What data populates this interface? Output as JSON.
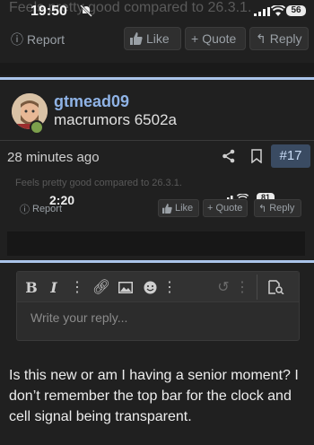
{
  "statusbar": {
    "time": "19:50",
    "battery": "56"
  },
  "prev_post": {
    "ghost_text": "Feels pretty good compared to 26.3.1.",
    "actions": {
      "report": "Report",
      "like": "Like",
      "quote": "Quote",
      "reply": "Reply"
    }
  },
  "post": {
    "username": "gtmead09",
    "user_title": "macrumors 6502a",
    "time_ago": "28 minutes ago",
    "post_number": "#17",
    "screenshot": {
      "ghost_text": "Feels pretty good compared to 26.3.1.",
      "time": "2:20",
      "battery": "81",
      "actions": {
        "report": "Report",
        "like": "Like",
        "quote": "Quote",
        "reply": "Reply"
      }
    }
  },
  "editor": {
    "toolbar": {
      "bold": "B",
      "italic": "I"
    },
    "placeholder": "Write your reply..."
  },
  "comment_text": "Is this new or am I having a senior moment? I don’t remember the top bar for the clock and cell signal being transparent.",
  "colors": {
    "background": "#202020",
    "accent_line": "#aac4ea",
    "username": "#8fb3e6",
    "post_number_bg": "#3a4b62"
  }
}
